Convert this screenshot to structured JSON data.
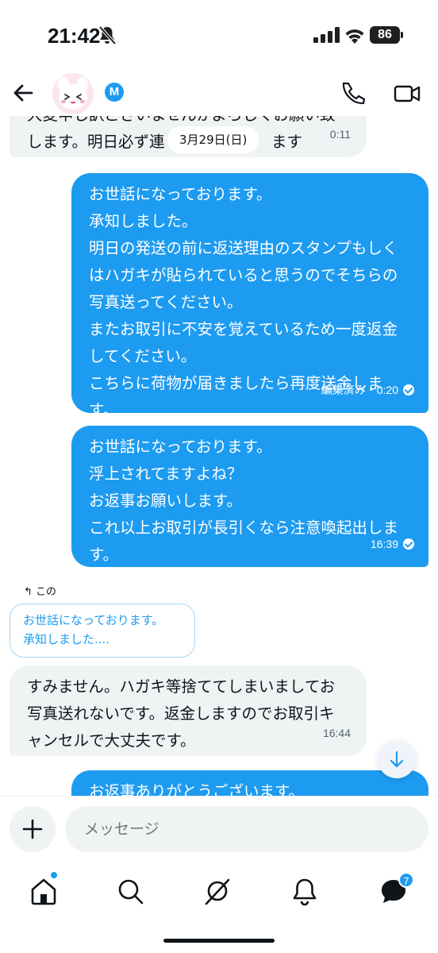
{
  "status_bar": {
    "time": "21:42",
    "battery": "86"
  },
  "header": {
    "verified_badge": "M"
  },
  "messages": {
    "date_pill": "3月29日(日)",
    "msg1": {
      "lines": [
        "大変申し訳ございませんがよろしくお願い致",
        "します。明日必ず連",
        "ます"
      ],
      "time": "0:11"
    },
    "msg2": {
      "lines": [
        "お世話になっております。",
        "承知しました。",
        "明日の発送の前に返送理由のスタンプもしく",
        "はハガキが貼られていると思うのでそちらの",
        "写真送ってください。",
        "またお取引に不安を覚えているため一度返金",
        "してください。",
        "こちらに荷物が届きましたら再度送金しま",
        "す。"
      ],
      "meta": "編集済み・0:20"
    },
    "msg3": {
      "lines": [
        "お世話になっております。",
        "浮上されてますよね？",
        "お返事お願いします。",
        "これ以上お取引が長引くなら注意喚起出しま",
        "す。"
      ],
      "time": "16:39"
    },
    "reply_label": "この",
    "reply_quote": [
      "お世話になっております。",
      "承知しました...."
    ],
    "msg4": {
      "lines": [
        "すみません。ハガキ等捨ててしまいましてお",
        "写真送れないです。返金しますのでお取引キ",
        "ャンセルで大丈夫です。"
      ],
      "time": "16:44"
    },
    "msg5": {
      "lines": [
        "お返事ありがとうございます。"
      ]
    }
  },
  "composer": {
    "placeholder": "メッセージ"
  },
  "tabbar": {
    "messages_badge": "7"
  },
  "colors": {
    "accent": "#1d9bf0",
    "incoming_bg": "#eff3f4",
    "text": "#0f1419"
  },
  "icons": [
    "back-arrow-icon",
    "phone-icon",
    "video-icon",
    "plus-icon",
    "home-icon",
    "search-icon",
    "grok-icon",
    "bell-icon",
    "mail-icon",
    "arrow-down-icon",
    "reply-icon",
    "bell-off-icon"
  ]
}
